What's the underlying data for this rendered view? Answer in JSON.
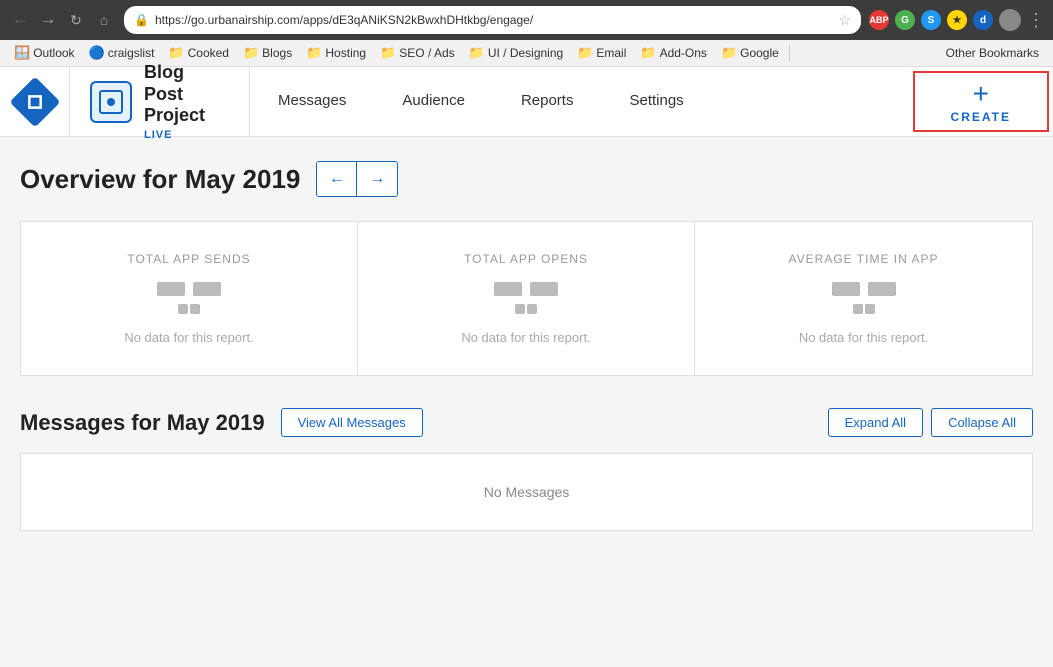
{
  "browser": {
    "url": "https://go.urbanairship.com/apps/dE3qANiKSN2kBwxhDHtkbg/engage/",
    "back_disabled": false,
    "forward_disabled": false
  },
  "bookmarks": {
    "items": [
      {
        "id": "outlook",
        "label": "Outlook",
        "icon": "📧"
      },
      {
        "id": "craigslist",
        "label": "craigslist",
        "icon": "🔵"
      },
      {
        "id": "cooked",
        "label": "Cooked",
        "icon": "📁"
      },
      {
        "id": "blogs",
        "label": "Blogs",
        "icon": "📁"
      },
      {
        "id": "hosting",
        "label": "Hosting",
        "icon": "📁"
      },
      {
        "id": "seo-ads",
        "label": "SEO / Ads",
        "icon": "📁"
      },
      {
        "id": "ui-designing",
        "label": "UI / Designing",
        "icon": "📁"
      },
      {
        "id": "email",
        "label": "Email",
        "icon": "📁"
      },
      {
        "id": "add-ons",
        "label": "Add-Ons",
        "icon": "📁"
      },
      {
        "id": "google",
        "label": "Google",
        "icon": "📁"
      }
    ],
    "other_label": "Other Bookmarks"
  },
  "app": {
    "logo_alt": "Urban Airship",
    "project": {
      "name_line1": "Blog",
      "name_line2": "Post",
      "name_line3": "Project",
      "status": "LIVE"
    },
    "nav": {
      "items": [
        {
          "id": "messages",
          "label": "Messages"
        },
        {
          "id": "audience",
          "label": "Audience"
        },
        {
          "id": "reports",
          "label": "Reports"
        },
        {
          "id": "settings",
          "label": "Settings"
        }
      ]
    },
    "create": {
      "plus": "+",
      "label": "CREATE"
    }
  },
  "main": {
    "overview_title": "Overview for May 2019",
    "stats": [
      {
        "id": "total-app-sends",
        "label": "TOTAL APP SENDS",
        "no_data": "No data for this report."
      },
      {
        "id": "total-app-opens",
        "label": "TOTAL APP OPENS",
        "no_data": "No data for this report."
      },
      {
        "id": "average-time-in-app",
        "label": "AVERAGE TIME IN APP",
        "no_data": "No data for this report."
      }
    ],
    "messages_title": "Messages for May 2019",
    "view_all_label": "View All Messages",
    "expand_all_label": "Expand All",
    "collapse_all_label": "Collapse All",
    "no_messages": "No Messages"
  }
}
